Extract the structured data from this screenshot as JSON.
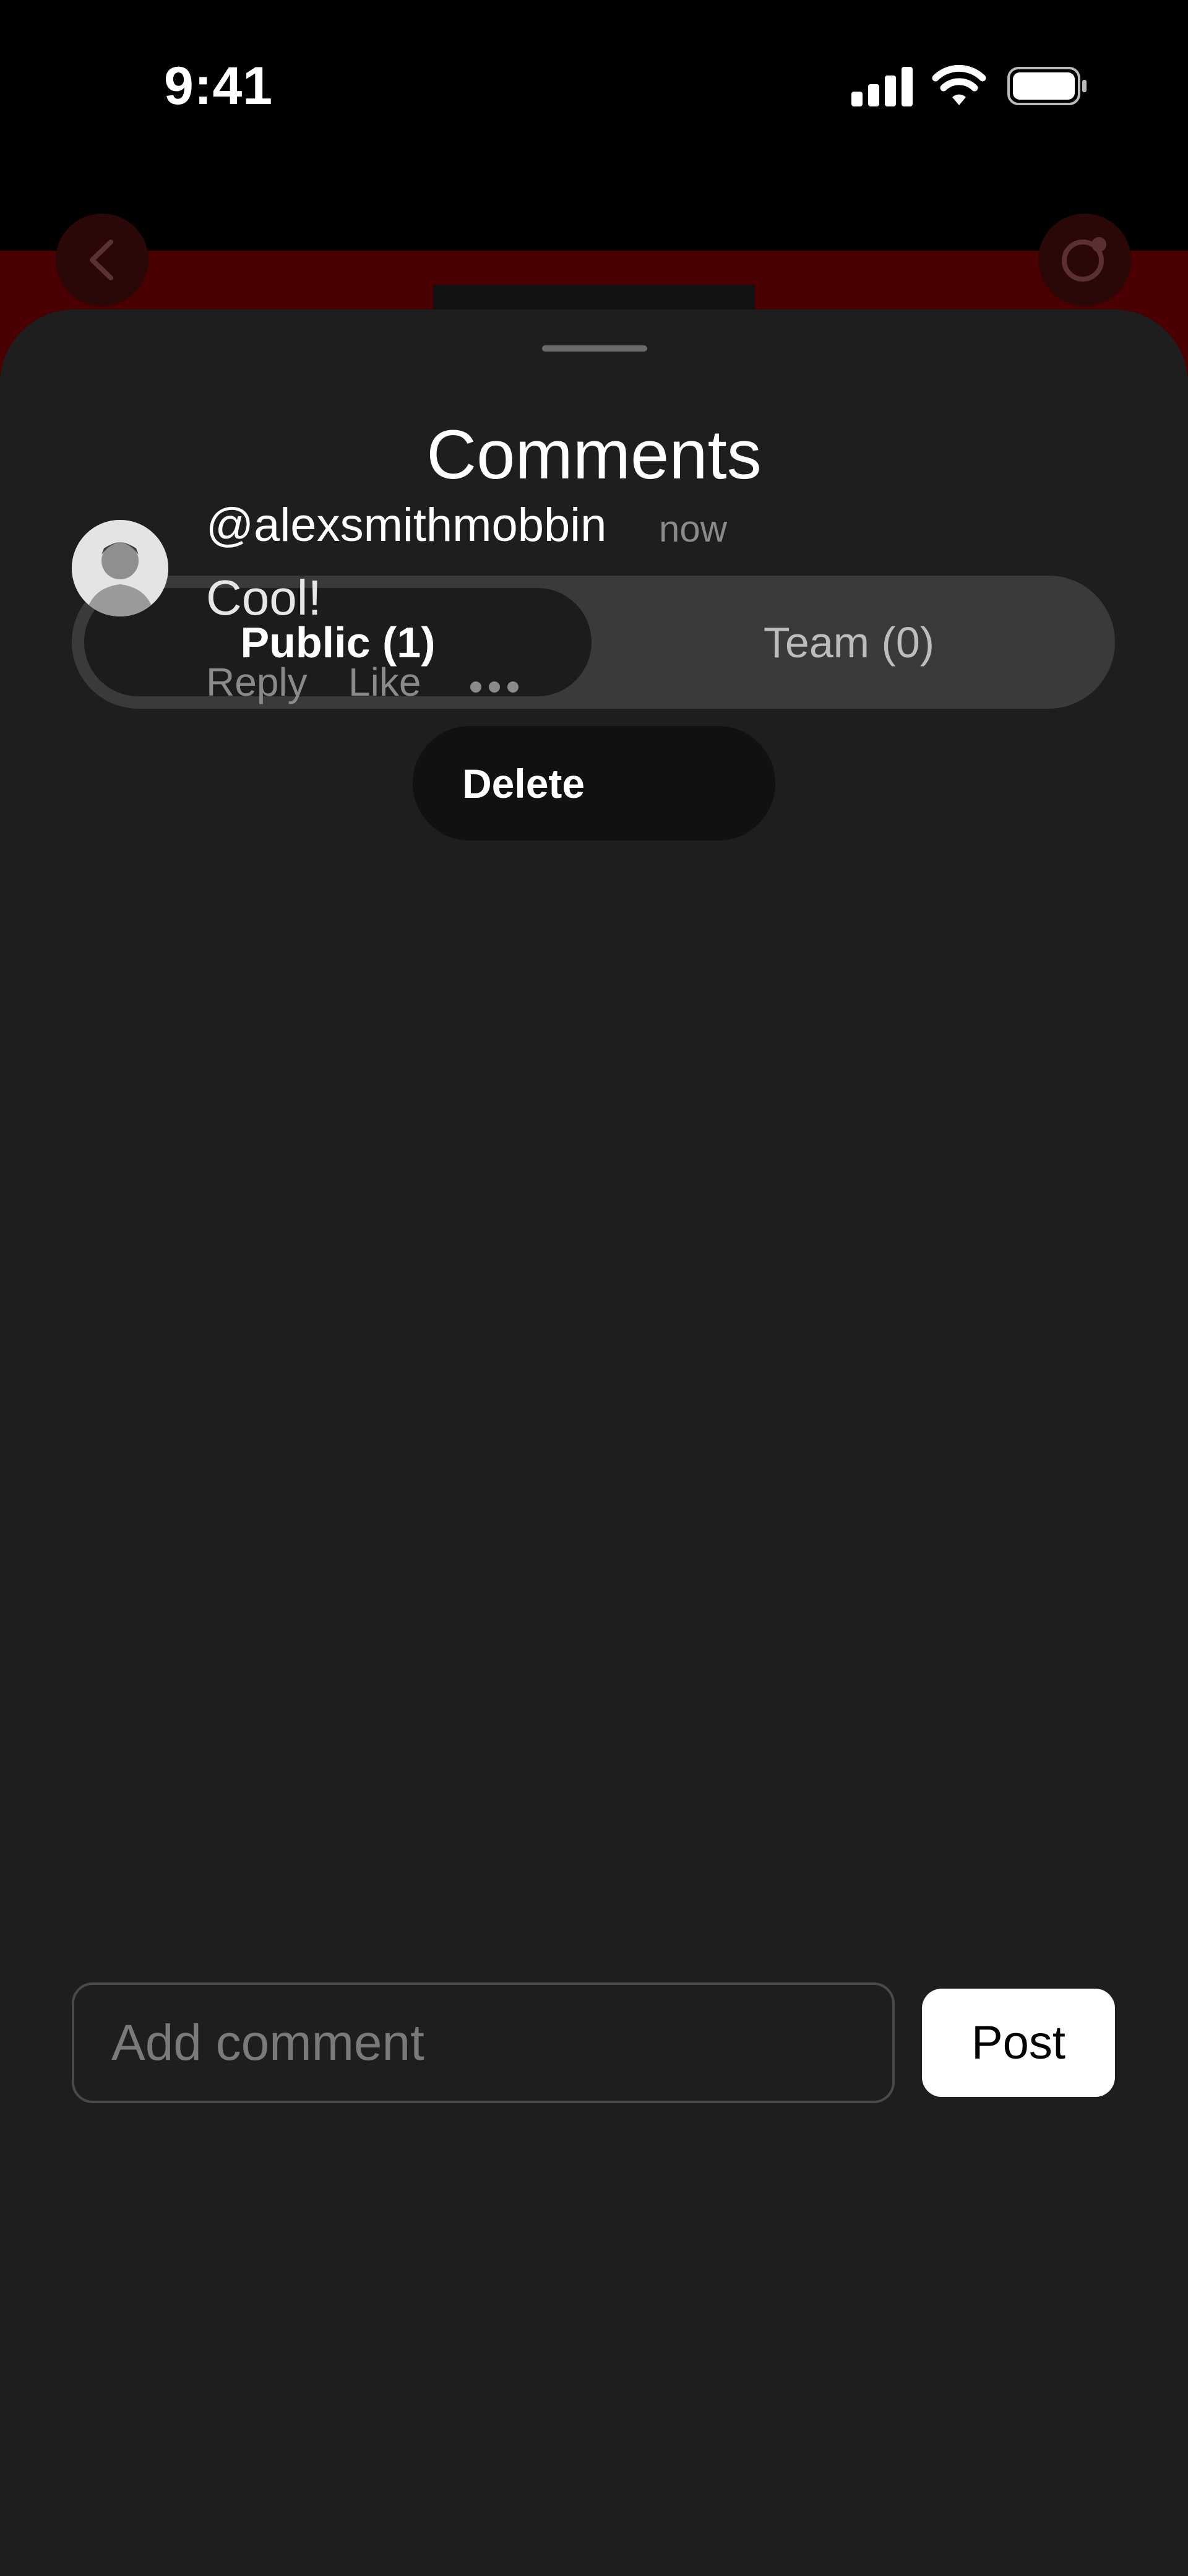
{
  "status_bar": {
    "time": "9:41"
  },
  "sheet": {
    "title": "Comments",
    "tabs": [
      {
        "label": "Public (1)",
        "selected": true
      },
      {
        "label": "Team (0)",
        "selected": false
      }
    ]
  },
  "comments": [
    {
      "username": "@alexsmithmobbin",
      "time": "now",
      "text": "Cool!",
      "actions": {
        "reply": "Reply",
        "like": "Like"
      }
    }
  ],
  "context_menu": {
    "delete_label": "Delete"
  },
  "composer": {
    "placeholder": "Add comment",
    "value": "",
    "post_label": "Post"
  },
  "icons": [
    "signal-icon",
    "wifi-icon",
    "battery-icon",
    "back-icon",
    "comment-search-icon",
    "more-icon"
  ],
  "colors": {
    "sheet_bg": "#1e1e1e",
    "segment_bg": "#3a3a3a",
    "selected_segment": "#1c1c1c",
    "backdrop": "#4a0000"
  }
}
